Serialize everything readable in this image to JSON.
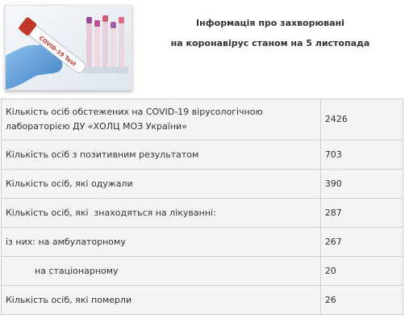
{
  "header": {
    "title_line1": "Інформація про захворювані",
    "title_line2": "на коронавірус станом на 5 листопада",
    "photo_label": "COVID-19 Test"
  },
  "stats": {
    "rows": [
      {
        "label": "Кількість осіб обстежених на COVID-19 вірусологічною лабораторією ДУ «ХОЛЦ МОЗ України»",
        "value": "2426"
      },
      {
        "label": "Кількість осіб з позитивним результатом",
        "value": "703"
      },
      {
        "label": "Кількість осіб, які одужали",
        "value": "390"
      },
      {
        "label": "Кількість осіб, які  знаходяться на лікуванні:",
        "value": "287"
      },
      {
        "label": "із них: на амбулаторному",
        "value": "267"
      },
      {
        "label": "на стаціонарному",
        "value": "20"
      },
      {
        "label": "Кількість осіб, які померли",
        "value": "26"
      }
    ]
  },
  "colors": {
    "cell_background": "#f4f4f4",
    "cell_border": "#cfcfcf",
    "text": "#333333",
    "glove": "#5a9ad8",
    "tube_cap": "#c0392b"
  }
}
